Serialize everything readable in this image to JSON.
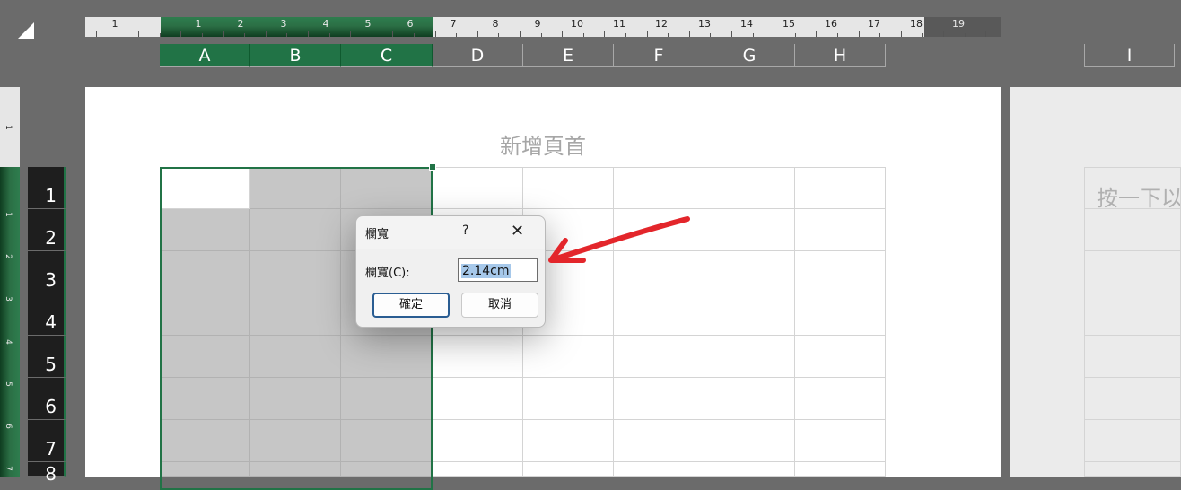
{
  "ruler": {
    "top_numbers": [
      "1",
      "1",
      "2",
      "3",
      "4",
      "5",
      "6",
      "7",
      "8",
      "9",
      "10",
      "11",
      "12",
      "13",
      "14",
      "15",
      "16",
      "17",
      "18",
      "19"
    ],
    "left_numbers": [
      "1",
      "1",
      "2",
      "3",
      "4",
      "5",
      "6",
      "7"
    ]
  },
  "columns": [
    "A",
    "B",
    "C",
    "D",
    "E",
    "F",
    "G",
    "H",
    "I"
  ],
  "rows": [
    "1",
    "2",
    "3",
    "4",
    "5",
    "6",
    "7",
    "8"
  ],
  "page": {
    "header_placeholder": "新增頁首",
    "click_placeholder": "按一下以"
  },
  "dialog": {
    "title": "欄寬",
    "help": "?",
    "close": "✕",
    "label": "欄寬(C):",
    "value": "2.14cm",
    "ok": "確定",
    "cancel": "取消"
  },
  "annotation": {
    "color": "#e3262b"
  },
  "colors": {
    "selection_green": "#217346"
  }
}
